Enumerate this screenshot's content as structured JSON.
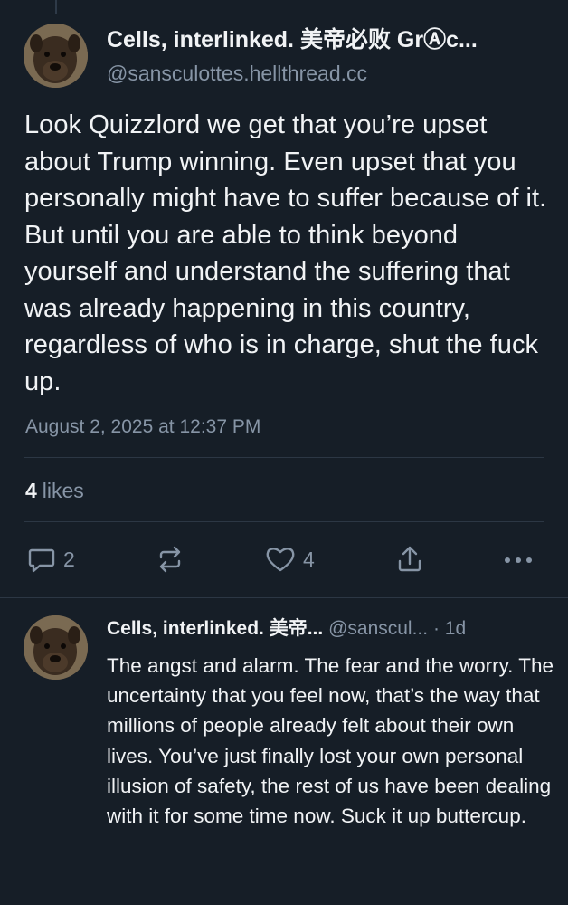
{
  "post": {
    "author_name": "Cells, interlinked. 美帝必败 GrⒶc...",
    "author_handle": "@sansculottes.hellthread.cc",
    "text": "Look Quizzlord we get that you’re upset about Trump winning. Even upset that you personally might have to suffer because of it. But until you are able to think beyond yourself and understand the suffering that was already happening in this country, regardless of who is in charge, shut the fuck up.",
    "timestamp": "August 2, 2025 at 12:37 PM",
    "likes_count": "4",
    "likes_label": "likes"
  },
  "actions": {
    "reply_count": "2",
    "like_count": "4",
    "icons": [
      "comment-icon",
      "repost-icon",
      "heart-icon",
      "share-icon",
      "more-icon"
    ]
  },
  "reply": {
    "author_name": "Cells, interlinked. 美帝...",
    "author_handle": "@sanscul...",
    "separator": "·",
    "time": "1d",
    "text": "The angst and alarm. The fear and the worry. The uncertainty that you feel now, that’s the way that millions of people already felt about their own lives. You’ve just finally lost your own personal illusion of safety, the rest of us have been dealing with it for some time now. Suck it up buttercup."
  },
  "colors": {
    "background": "#161e27",
    "primary_text": "#f1f3f5",
    "secondary_text": "#8795a6",
    "divider": "#2c3744"
  }
}
